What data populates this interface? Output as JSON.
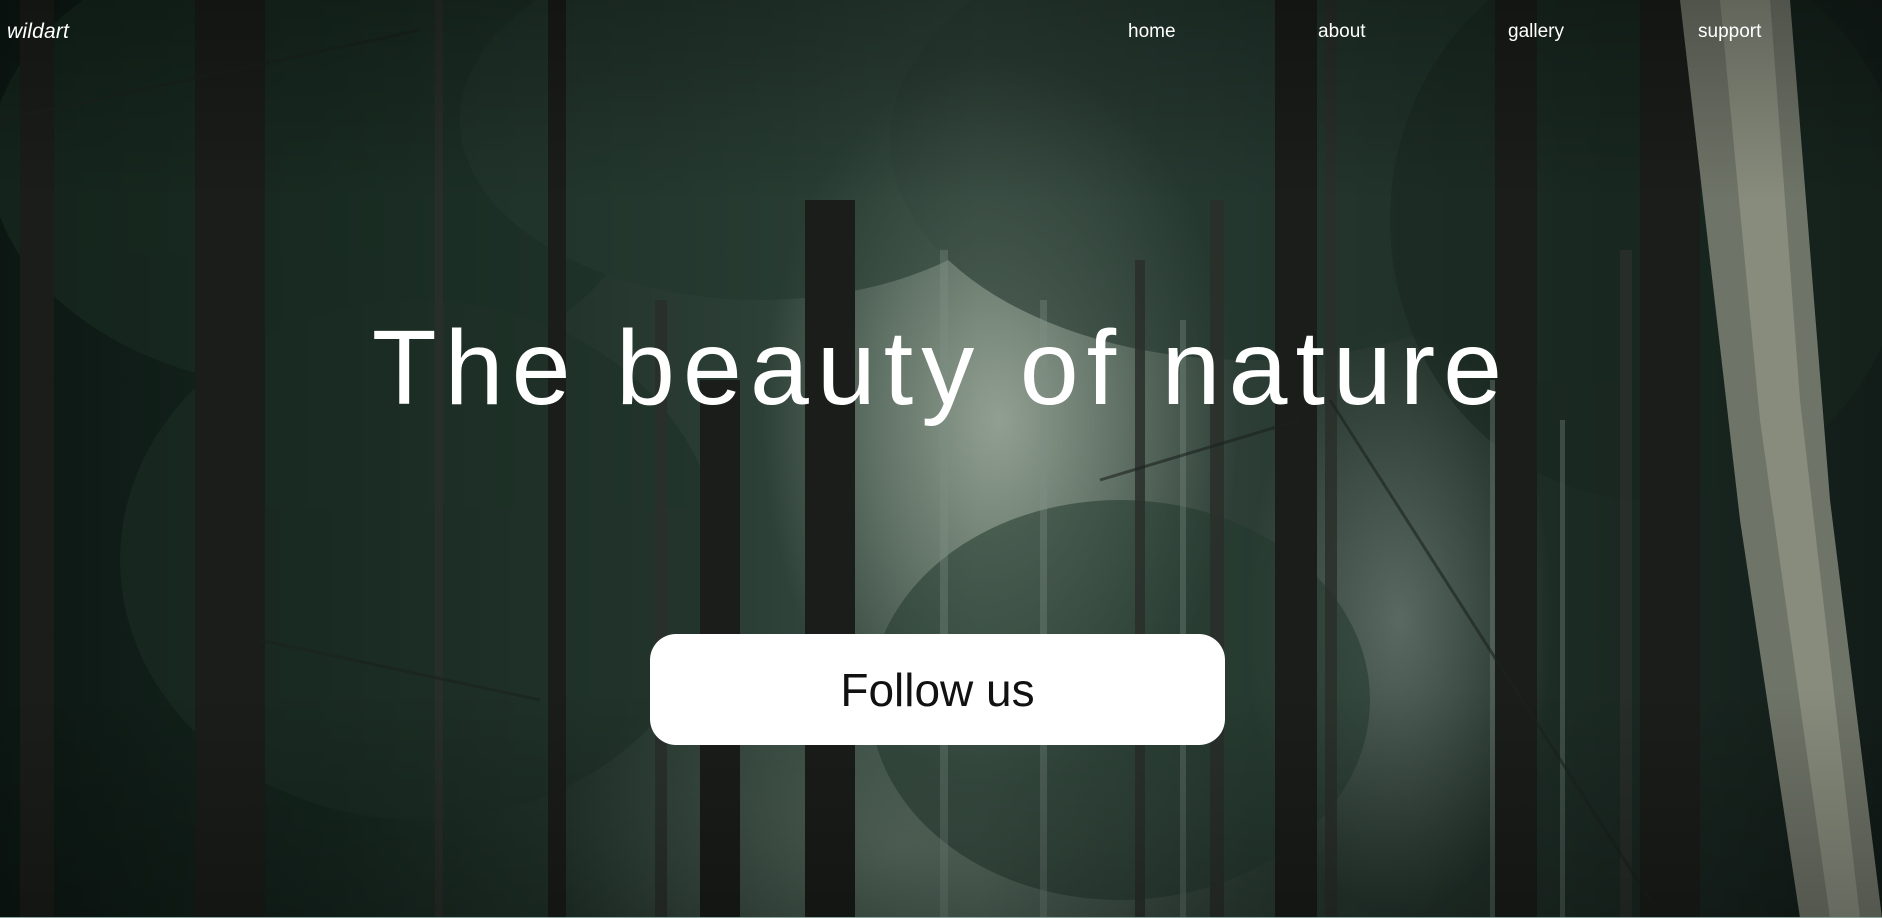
{
  "header": {
    "logo": "wildart",
    "nav": [
      {
        "label": "home"
      },
      {
        "label": "about"
      },
      {
        "label": "gallery"
      },
      {
        "label": "support"
      }
    ]
  },
  "hero": {
    "title": "The beauty of nature",
    "cta_label": "Follow us",
    "background_image": "misty-forest-photo"
  },
  "colors": {
    "text": "#ffffff",
    "button_bg": "#ffffff",
    "button_text": "#111111"
  }
}
